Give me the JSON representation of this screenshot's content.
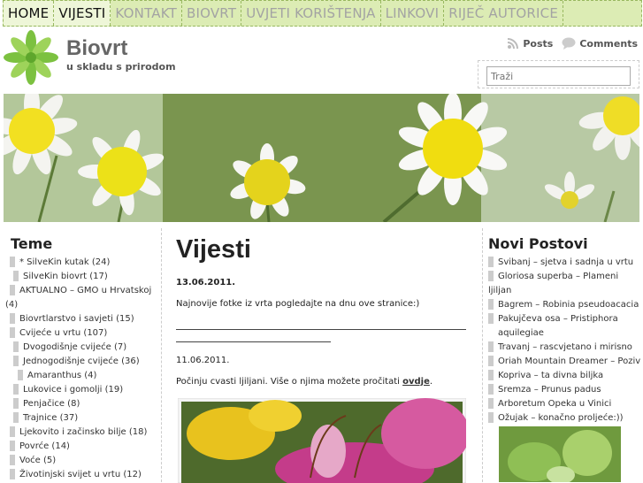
{
  "nav": {
    "items": [
      "HOME",
      "VIJESTI",
      "KONTAKT",
      "BIOVRT",
      "UVJETI KORIŠTENJA",
      "LINKOVI",
      "RIJEČ AUTORICE"
    ]
  },
  "header": {
    "title": "Biovrt",
    "description": "u skladu s prirodom",
    "posts_label": "Posts",
    "comments_label": "Comments",
    "search_placeholder": "Traži"
  },
  "left_sidebar": {
    "title": "Teme",
    "items": [
      {
        "label": "* SilveKin kutak (24)"
      },
      {
        "label": "SilveKin biovrt (17)"
      },
      {
        "label": "AKTUALNO – GMO u Hrvatskoj"
      },
      {
        "label": "(4)"
      },
      {
        "label": "Biovrtlarstvo i savjeti (15)"
      },
      {
        "label": "Cvijeće u vrtu (107)"
      },
      {
        "label": "Dvogodišnje cvijeće (7)"
      },
      {
        "label": "Jednogodišnje cvijeće (36)"
      },
      {
        "label": "Amaranthus (4)"
      },
      {
        "label": "Lukovice i gomolji (19)"
      },
      {
        "label": "Penjačice (8)"
      },
      {
        "label": "Trajnice (37)"
      },
      {
        "label": "Ljekovito i začinsko bilje (18)"
      },
      {
        "label": "Povrće (14)"
      },
      {
        "label": "Voće (5)"
      },
      {
        "label": "Životinjski svijet u vrtu (12)"
      }
    ]
  },
  "main": {
    "title": "Vijesti",
    "date1": "13.06.2011.",
    "text1": "Najnovije fotke iz vrta pogledajte na dnu ove stranice:)",
    "date2": "11.06.2011.",
    "text2_before": "Počinju cvasti ljiljani. Više o njima možete pročitati ",
    "text2_link": "ovdje",
    "text2_after": "."
  },
  "right_sidebar": {
    "title": "Novi Postovi",
    "items": [
      "Svibanj – sjetva i sadnja u vrtu",
      "Gloriosa superba – Plameni ljiljan",
      "Bagrem – Robinia pseudoacacia",
      "Pakujčeva osa – Pristiphora",
      "aquilegiae",
      "Travanj – rascvjetano i mirisno",
      "Oriah Mountain Dreamer – Poziv",
      "Kopriva – ta divna biljka",
      "Sremza – Prunus padus",
      "Arboretum Opeka u Vinici",
      "Ožujak – konačno proljeće:))"
    ]
  },
  "colors": {
    "nav_bg": "#dcecb4",
    "accent_green": "#98b860"
  }
}
